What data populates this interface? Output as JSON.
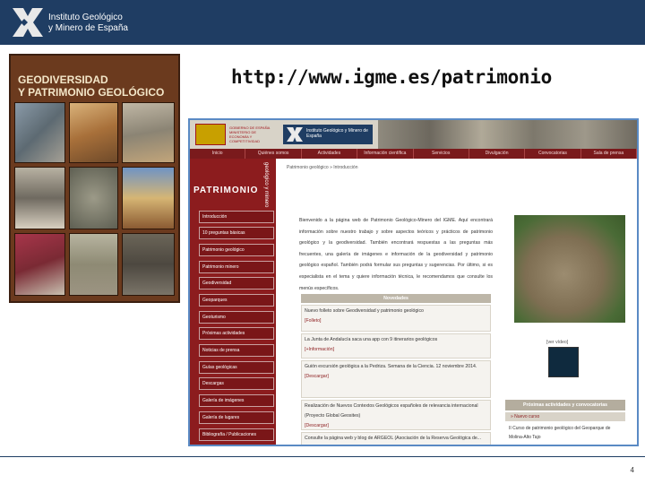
{
  "header": {
    "org_line1": "Instituto Geológico",
    "org_line2": "y Minero de España"
  },
  "url_title": "http://www.igme.es/patrimonio",
  "book": {
    "title_line1": "GEODIVERSIDAD",
    "title_line2": "Y PATRIMONIO GEOLÓGICO"
  },
  "website": {
    "gov_text": "GOBIERNO DE ESPAÑA MINISTERIO DE ECONOMÍA Y COMPETITIVIDAD",
    "igme_text": "Instituto Geológico y Minero de España",
    "nav": [
      "Inicio",
      "Quiénes somos",
      "Actividades",
      "Información científica",
      "Servicios",
      "Divulgación",
      "Convocatorias",
      "Sala de prensa"
    ],
    "breadcrumb": "Patrimonio geológico » Introducción",
    "sidebar_brand": "PATRIMONIO",
    "sidebar_brand_vert": "geológico y minero",
    "sidebar_items": [
      "Introducción",
      "10 preguntas básicas",
      "Patrimonio geológico",
      "Patrimonio minero",
      "Geodiversidad",
      "Geoparques",
      "Geoturismo",
      "Próximas actividades",
      "Noticias de prensa",
      "Guías geológicas",
      "Descargas",
      "Galería de imágenes",
      "Galería de lugares",
      "Bibliografía / Publicaciones"
    ],
    "intro_text": "Bienvenido a la página web de Patrimonio Geológico-Minero del IGME. Aquí encontrará información sobre nuestro trabajo y sobre aspectos teóricos y prácticos de patrimonio geológico y la geodiversidad. También encontrará respuestas a las preguntas más frecuentes, una galería de imágenes e información de la geodiversidad y patrimonio geológico español. También podrá formular sus preguntas y sugerencias. Por último, si es especialista en el tema y quiere información técnica, le recomendamos que consulte los menús específicos.",
    "news_heading": "Novedades",
    "news": [
      {
        "text": "Nuevo folleto sobre Geodiversidad y patrimonio geológico",
        "link": "[Folleto]"
      },
      {
        "text": "La Junta de Andalucía saca una app con 9 itinerarios geológicos",
        "link": "[+Información]"
      },
      {
        "text": "Guión excursión geológica a la Pedriza. Semana de la Ciencia. 12 noviembre 2014.",
        "link": "[Descargar]"
      },
      {
        "text": "Realización de Nuevos Contextos Geológicos españoles de relevancia internacional (Proyecto Global Geosites)",
        "link": "[Descargar]"
      },
      {
        "text": "Consulte la página web y blog de ARGEOL (Asociación de la Reserva Geológica de...",
        "link": ""
      }
    ],
    "video_label": "[ver vídeo]",
    "activities_heading": "Próximas actividades y convocatorias",
    "activities_sub": "» Nuevo curso",
    "activities_text": "II Curso de patrimonio geológico del Geoparque de Molina-Alto Tajo"
  },
  "page_number": "4",
  "colors": {
    "brand_navy": "#1f3d63",
    "site_maroon": "#8c1c1e",
    "site_border": "#5a8ac4"
  }
}
